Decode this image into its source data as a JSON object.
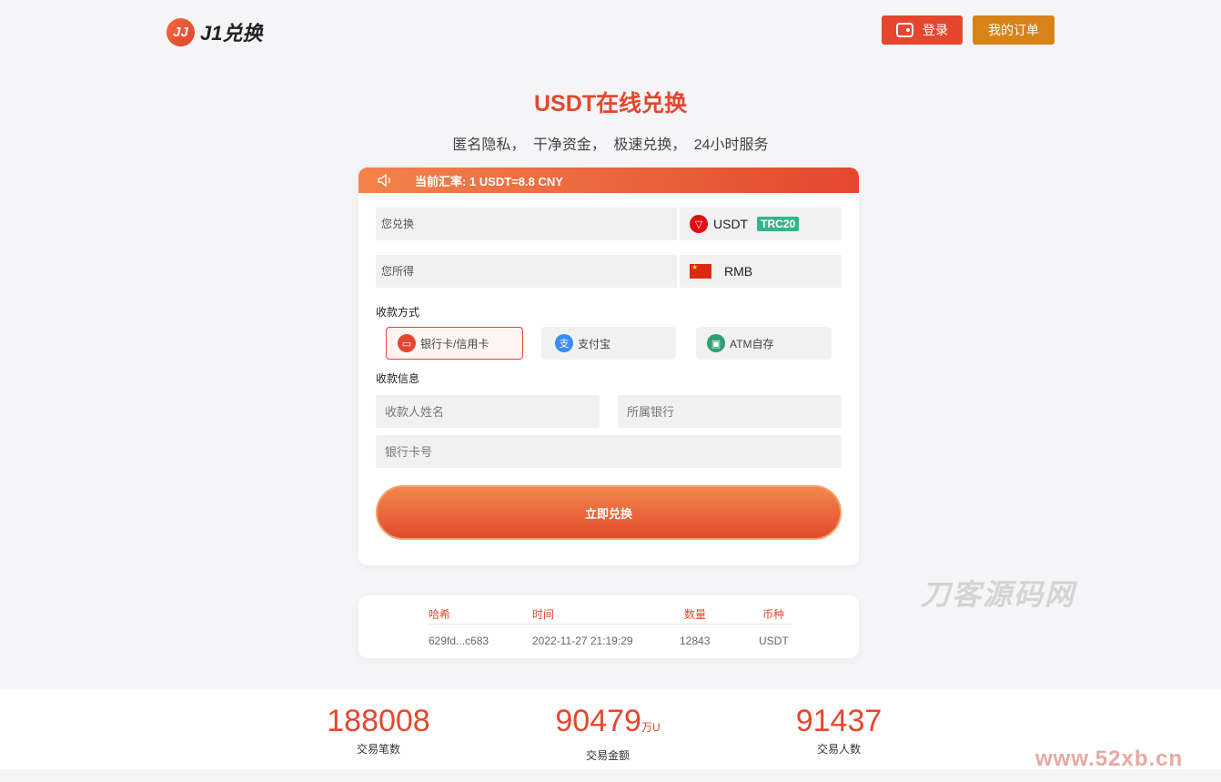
{
  "header": {
    "logo_mark": "JJ",
    "logo_text": "J1兑换",
    "login_label": "登录",
    "orders_label": "我的订单"
  },
  "hero": {
    "title": "USDT在线兑换",
    "subtitle": "匿名隐私， 干净资金， 极速兑换， 24小时服务"
  },
  "exchange": {
    "rate_text": "当前汇率: 1 USDT=8.8 CNY",
    "send_label": "您兑换",
    "send_currency": "USDT",
    "send_network": "TRC20",
    "receive_label": "您所得",
    "receive_currency": "RMB",
    "payment_method_label": "收款方式",
    "payment_methods": [
      {
        "label": "银行卡/信用卡",
        "icon": "bank-card-icon",
        "color": "#e5472e",
        "selected": true
      },
      {
        "label": "支付宝",
        "icon": "alipay-icon",
        "color": "#3b8cf5",
        "selected": false
      },
      {
        "label": "ATM自存",
        "icon": "atm-icon",
        "color": "#2e9e74",
        "selected": false
      }
    ],
    "payee_info_label": "收款信息",
    "payee_name_placeholder": "收款人姓名",
    "bank_placeholder": "所属银行",
    "card_number_placeholder": "银行卡号",
    "submit_label": "立即兑换"
  },
  "transactions": {
    "headers": [
      "哈希",
      "时间",
      "数量",
      "币种"
    ],
    "rows": [
      [
        "629fd...c683",
        "2022-11-27 21:19:29",
        "12843",
        "USDT"
      ]
    ]
  },
  "stats": [
    {
      "value": "188008",
      "unit": "",
      "label": "交易笔数"
    },
    {
      "value": "90479",
      "unit": "万U",
      "label": "交易金额"
    },
    {
      "value": "91437",
      "unit": "",
      "label": "交易人数"
    }
  ],
  "watermarks": {
    "site_name": "刀客源码网",
    "site_url": "www.52xb.cn"
  },
  "colors": {
    "accent": "#e5472e",
    "orders_button": "#d8821a",
    "trc_badge": "#37b38f"
  }
}
